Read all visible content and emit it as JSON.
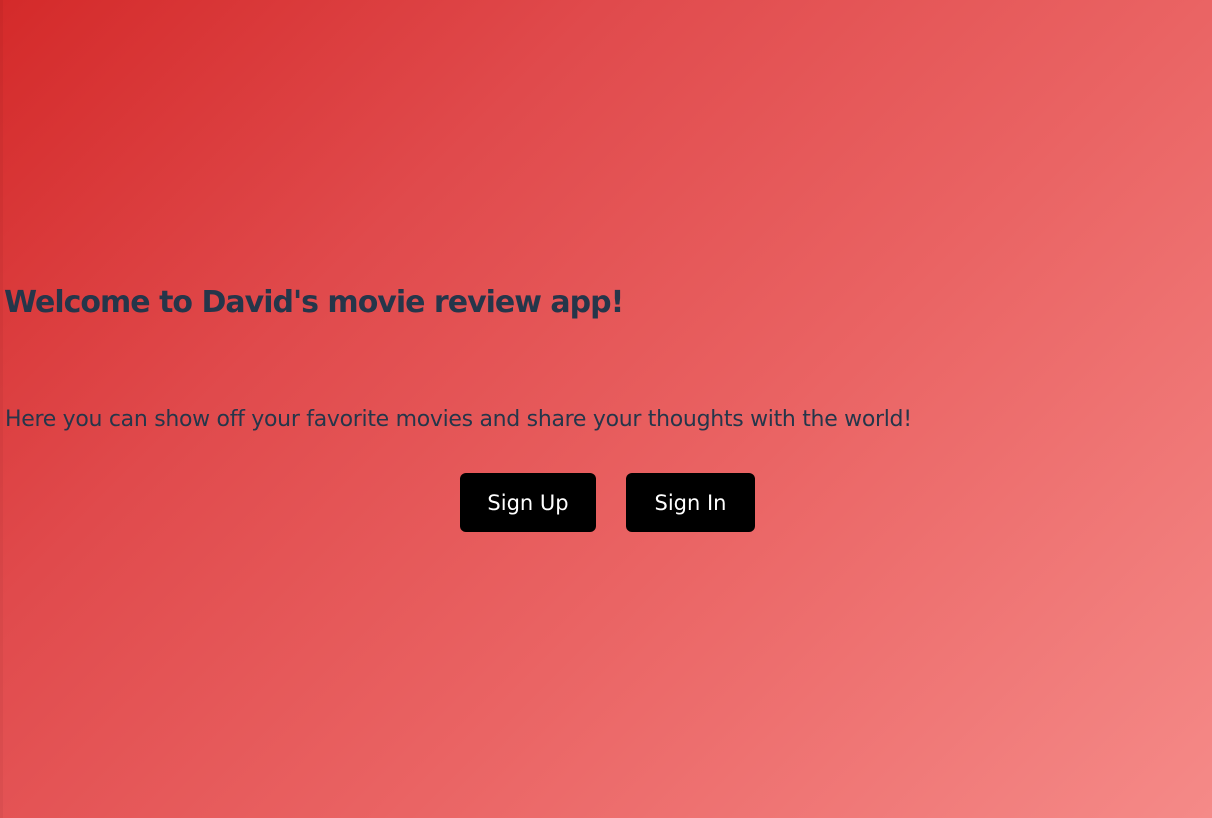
{
  "hero": {
    "title": "Welcome to David's movie review app!",
    "subtitle": "Here you can show off your favorite movies and share your thoughts with the world!"
  },
  "actions": {
    "sign_up_label": "Sign Up",
    "sign_in_label": "Sign In"
  },
  "colors": {
    "gradient_start": "#d42a2a",
    "gradient_end": "#f58a88",
    "text": "#25364a",
    "button_bg": "#000000",
    "button_text": "#ffffff"
  }
}
